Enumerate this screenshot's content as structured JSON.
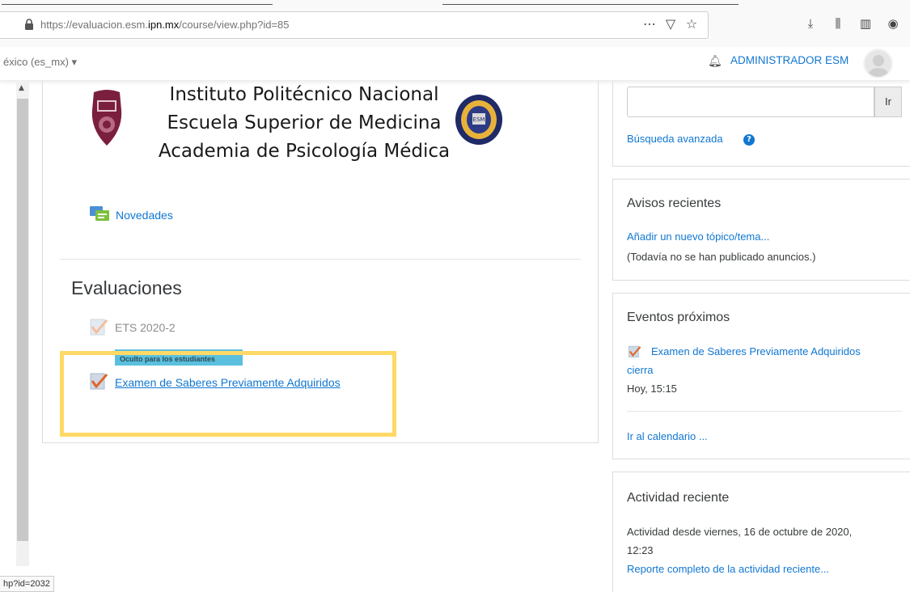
{
  "browser": {
    "url_prefix": "https://evaluacion.esm.",
    "url_domain": "ipn.mx",
    "url_path": "/course/view.php?id=85",
    "page_actions": [
      "⋯",
      "▽",
      "☆"
    ],
    "tools": [
      "⤓",
      "⫼",
      "▥",
      "◉"
    ],
    "status_url": "hp?id=2032"
  },
  "navbar": {
    "language": "éxico (es_mx) ▾",
    "user_name": "ADMINISTRADOR ESM"
  },
  "header": {
    "line1": "Instituto Politécnico Nacional",
    "line2": "Escuela Superior de Medicina",
    "line3": "Academia de Psicología Médica"
  },
  "course": {
    "news_label": "Novedades",
    "section_title": "Evaluaciones",
    "activities": [
      {
        "name": "ETS 2020-2"
      },
      {
        "name": "Examen de Saberes Previamente Adquiridos",
        "badge": "Oculto para los estudiantes"
      }
    ]
  },
  "sidebar": {
    "search": {
      "button": "Ir",
      "advanced": "Búsqueda avanzada",
      "value": ""
    },
    "news": {
      "title": "Avisos recientes",
      "add_link": "Añadir un nuevo tópico/tema...",
      "empty": "(Todavía no se han publicado anuncios.)"
    },
    "events": {
      "title": "Eventos próximos",
      "event_name": "Examen de Saberes Previamente Adquiridos",
      "event_suffix": "cierra",
      "event_time": "Hoy, 15:15",
      "calendar_link": "Ir al calendario ..."
    },
    "activity": {
      "title": "Actividad reciente",
      "since_line1": "Actividad desde viernes, 16 de octubre de 2020,",
      "since_line2": "12:23",
      "report_link": "Reporte completo de la actividad reciente..."
    }
  },
  "colors": {
    "link": "#1177d1",
    "highlight": "#ffd966",
    "badge": "#5bc0de"
  }
}
